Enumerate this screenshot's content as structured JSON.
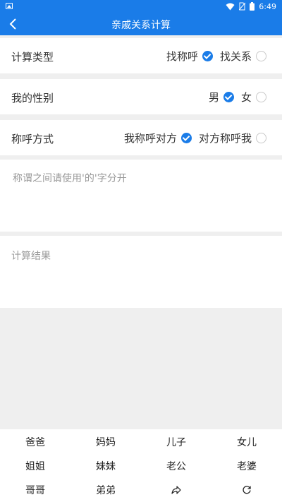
{
  "status": {
    "time": "6:49"
  },
  "appbar": {
    "title": "亲戚关系计算",
    "back_icon": "back-arrow-icon"
  },
  "calc_type": {
    "label": "计算类型",
    "options": [
      {
        "label": "找称呼",
        "checked": true
      },
      {
        "label": "找关系",
        "checked": false
      }
    ]
  },
  "gender": {
    "label": "我的性别",
    "options": [
      {
        "label": "男",
        "checked": true
      },
      {
        "label": "女",
        "checked": false
      }
    ]
  },
  "address_mode": {
    "label": "称呼方式",
    "options": [
      {
        "label": "我称呼对方",
        "checked": true
      },
      {
        "label": "对方称呼我",
        "checked": false
      }
    ]
  },
  "input": {
    "placeholder": "称谓之间请使用'的'字分开",
    "value": ""
  },
  "result": {
    "label": "计算结果"
  },
  "keyboard": {
    "keys": [
      "爸爸",
      "妈妈",
      "儿子",
      "女儿",
      "姐姐",
      "妹妹",
      "老公",
      "老婆",
      "哥哥",
      "弟弟"
    ],
    "share_icon": "share-arrow-icon",
    "reset_icon": "refresh-icon"
  },
  "colors": {
    "primary": "#1a7ce8",
    "background": "#efefef"
  }
}
